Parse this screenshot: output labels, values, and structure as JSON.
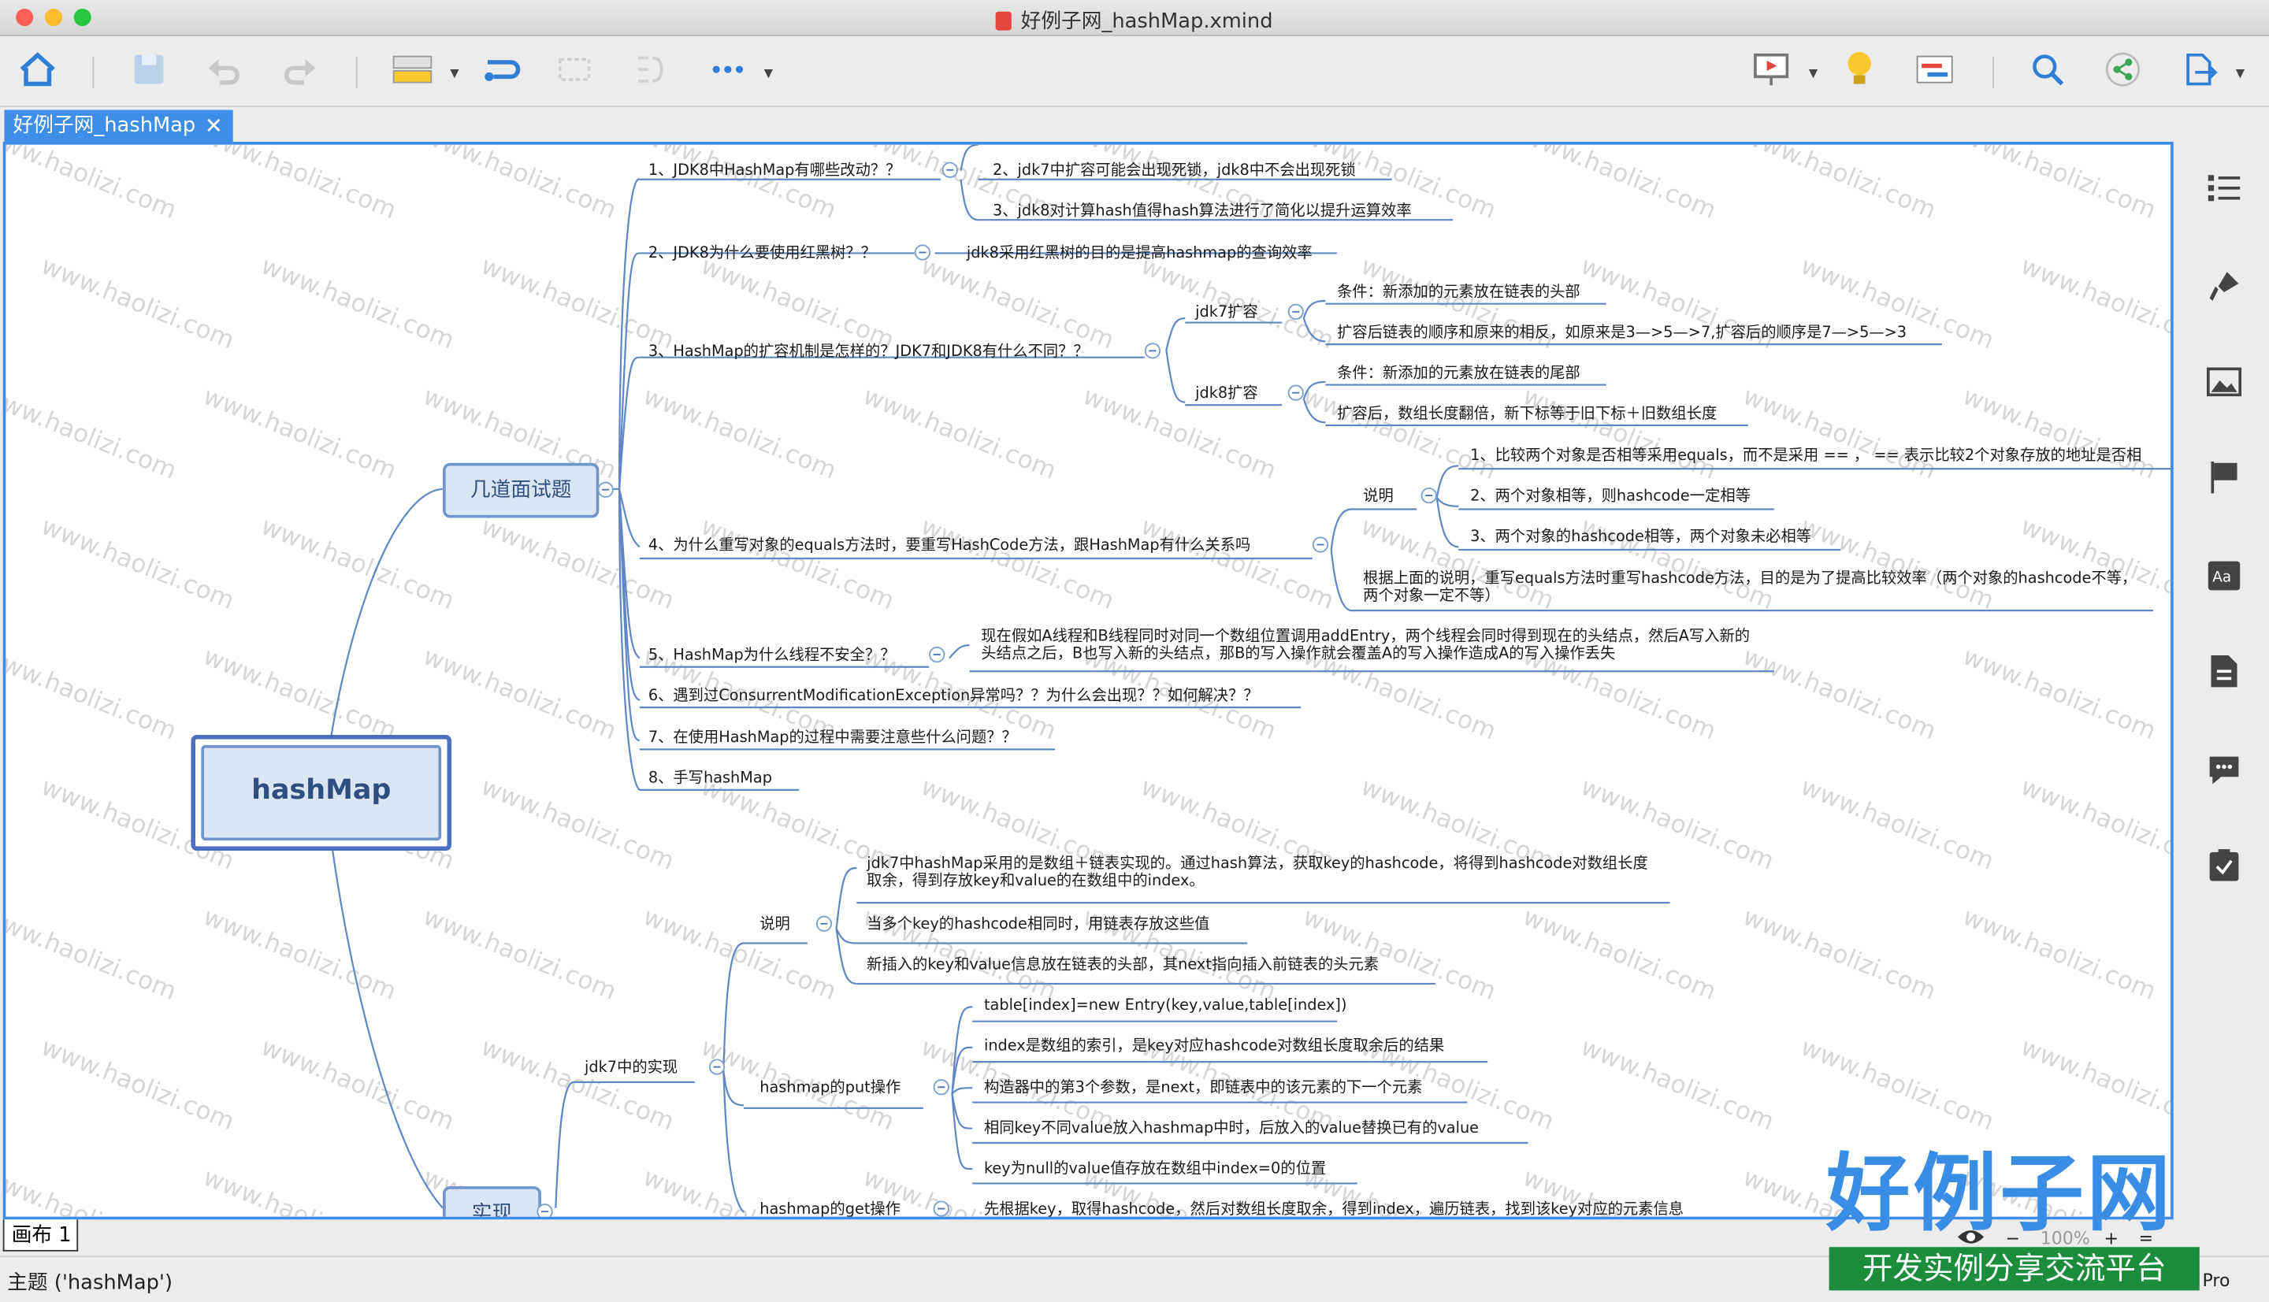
{
  "window": {
    "title": "好例子网_hashMap.xmind"
  },
  "tab": {
    "label": "好例子网_hashMap",
    "close": "✕"
  },
  "watermark": "www.haolizi.com",
  "root": "hashMap",
  "branch1": {
    "label": "几道面试题",
    "q1": "1、JDK8中HashMap有哪些改动？？",
    "q1a": "2、jdk7中扩容可能会出现死锁，jdk8中不会出现死锁",
    "q1b": "3、jdk8对计算hash值得hash算法进行了简化以提升运算效率",
    "q2": "2、JDK8为什么要使用红黑树？？",
    "q2a": "jdk8采用红黑树的目的是提高hashmap的查询效率",
    "q3": "3、HashMap的扩容机制是怎样的？JDK7和JDK8有什么不同？？",
    "q3_jdk7": "jdk7扩容",
    "q3_jdk7a": "条件：新添加的元素放在链表的头部",
    "q3_jdk7b": "扩容后链表的顺序和原来的相反，如原来是3—>5—>7,扩容后的顺序是7—>5—>3",
    "q3_jdk8": "jdk8扩容",
    "q3_jdk8a": "条件：新添加的元素放在链表的尾部",
    "q3_jdk8b": "扩容后，数组长度翻倍，新下标等于旧下标＋旧数组长度",
    "q4": "4、为什么重写对象的equals方法时，要重写HashCode方法，跟HashMap有什么关系吗",
    "q4_desc": "说明",
    "q4_d1": "1、比较两个对象是否相等采用equals，而不是采用 == ， == 表示比较2个对象存放的地址是否相",
    "q4_d2": "2、两个对象相等，则hashcode一定相等",
    "q4_d3": "3、两个对象的hashcode相等，两个对象未必相等",
    "q4_b": "根据上面的说明，重写equals方法时重写hashcode方法，目的是为了提高比较效率（两个对象的hashcode不等，两个对象一定不等）",
    "q5": "5、HashMap为什么线程不安全？？",
    "q5a": "现在假如A线程和B线程同时对同一个数组位置调用addEntry，两个线程会同时得到现在的头结点，然后A写入新的头结点之后，B也写入新的头结点，那B的写入操作就会覆盖A的写入操作造成A的写入操作丢失",
    "q6": "6、遇到过ConsurrentModificationException异常吗？？为什么会出现？？如何解决？？",
    "q7": "7、在使用HashMap的过程中需要注意些什么问题？？",
    "q8": "8、手写hashMap"
  },
  "branch2": {
    "label": "实现",
    "jdk7": "jdk7中的实现",
    "desc": "说明",
    "desc1": "jdk7中hashMap采用的是数组＋链表实现的。通过hash算法，获取key的hashcode，将得到hashcode对数组长度取余，得到存放key和value的在数组中的index。",
    "desc2": "当多个key的hashcode相同时，用链表存放这些值",
    "desc3": "新插入的key和value信息放在链表的头部，其next指向插入前链表的头元素",
    "put": "hashmap的put操作",
    "put1": "table[index]=new Entry(key,value,table[index])",
    "put2": "index是数组的索引，是key对应hashcode对数组长度取余后的结果",
    "put3": "构造器中的第3个参数，是next，即链表中的该元素的下一个元素",
    "put4": "相同key不同value放入hashmap中时，后放入的value替换已有的value",
    "put5": "key为null的value值存放在数组中index=0的位置",
    "get": "hashmap的get操作",
    "get1": "先根据key，取得hashcode，然后对数组长度取余，得到index，遍历链表，找到该key对应的元素信息"
  },
  "sheet": {
    "label": "画布 1"
  },
  "zoom": {
    "value": "100%",
    "minus": "−",
    "plus": "+",
    "eq": "="
  },
  "status": {
    "text": "主题 ('hashMap')"
  },
  "pro": "Pro",
  "logo": {
    "big": "好例子网",
    "band": "开发实例分享交流平台"
  },
  "colors": {
    "accent": "#3c8ee6",
    "line": "#5f87c4",
    "node_fill": "#dbe6f5"
  }
}
